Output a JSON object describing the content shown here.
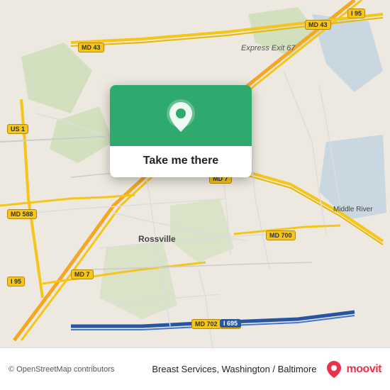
{
  "map": {
    "attribution": "© OpenStreetMap contributors",
    "center_label": "Rossville",
    "express_exit": "Express Exit 67",
    "place_label_right": "Middle River",
    "accent_color": "#2eaa6e"
  },
  "popup": {
    "cta_label": "Take me there",
    "icon": "location-pin"
  },
  "bottom_bar": {
    "place_name": "Breast Services, Washington / Baltimore",
    "copyright": "© OpenStreetMap contributors",
    "moovit_text": "moovit"
  },
  "road_labels": {
    "i95_top": "I 95",
    "i95_left": "I 95",
    "i95_bottom_left": "I 95",
    "i695": "I 695",
    "md43": "MD 43",
    "md43_right": "MD 43",
    "md7_mid": "MD 7",
    "md7_bottom": "MD 7",
    "md700": "MD 700",
    "md588": "MD 588",
    "us1": "US 1",
    "md702": "MD 702"
  }
}
